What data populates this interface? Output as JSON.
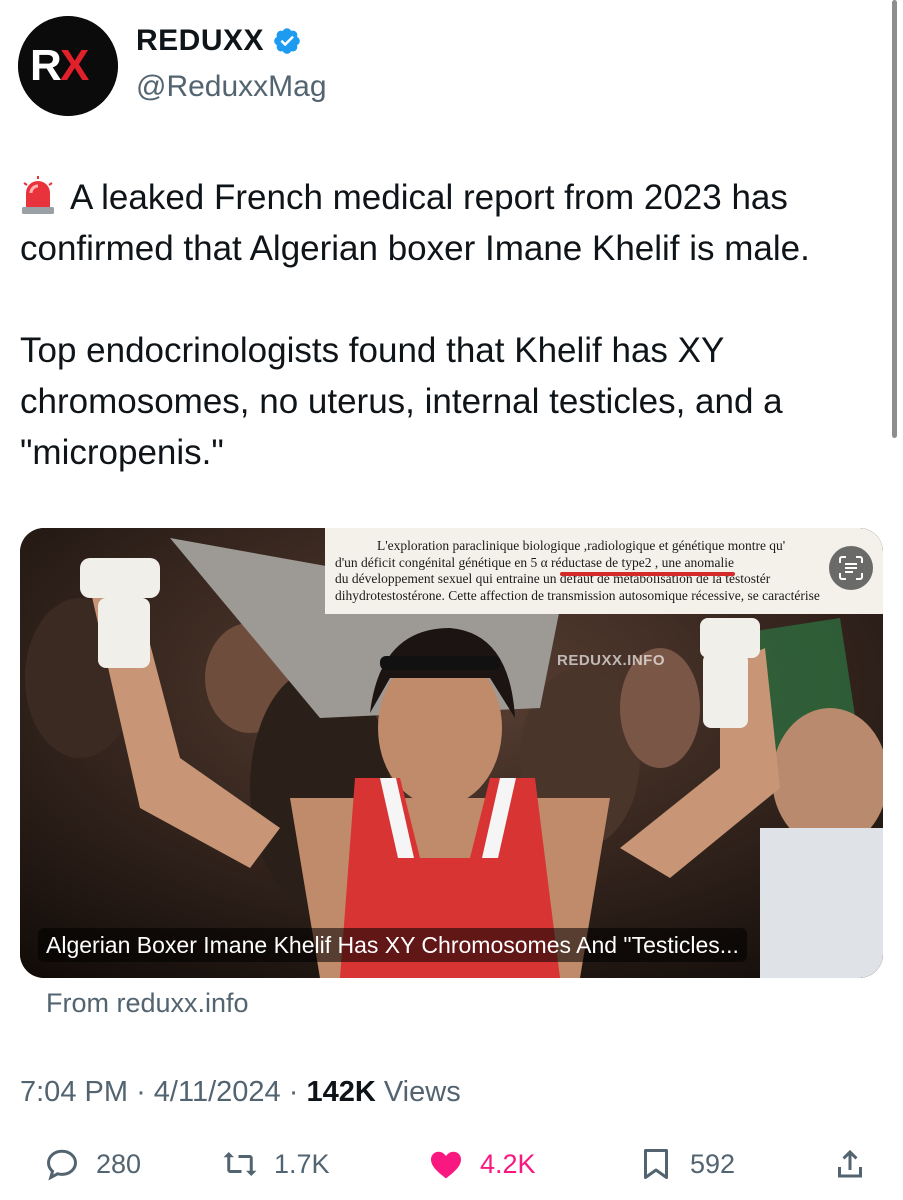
{
  "author": {
    "display_name": "REDUXX",
    "handle": "@ReduxxMag",
    "verified": true,
    "avatar_text": "RX",
    "verified_color": "#1d9bf0"
  },
  "tweet": {
    "emoji_icon": "police-light-icon",
    "text": "A leaked French medical report from 2023 has confirmed that Algerian boxer Imane Khelif is male.\n\nTop endocrinologists found that Khelif has XY chromosomes, no uterus, internal testicles, and a \"micropenis.\""
  },
  "link_card": {
    "document_excerpt": {
      "line1": "L'exploration paraclinique biologique ,radiologique et génétique montre qu'",
      "line2": "d'un déficit congénital génétique en 5 α réductase de type2 , une anomalie",
      "line3": "du développement sexuel qui entraine un défaut de métabolisation de la testostér",
      "line4": "dihydrotestostérone. Cette affection de transmission autosomique récessive, se caractérise"
    },
    "watermark": "REDUXX.INFO",
    "caption": "Algerian Boxer Imane Khelif Has XY Chromosomes And \"Testicles...",
    "source": "From reduxx.info"
  },
  "meta": {
    "time": "7:04 PM",
    "separator": "·",
    "date": "4/11/2024",
    "views_count": "142K",
    "views_label": "Views"
  },
  "actions": {
    "replies": "280",
    "reposts": "1.7K",
    "likes": "4.2K",
    "bookmarks": "592",
    "like_color": "#f91880",
    "icon_color": "#536471"
  }
}
